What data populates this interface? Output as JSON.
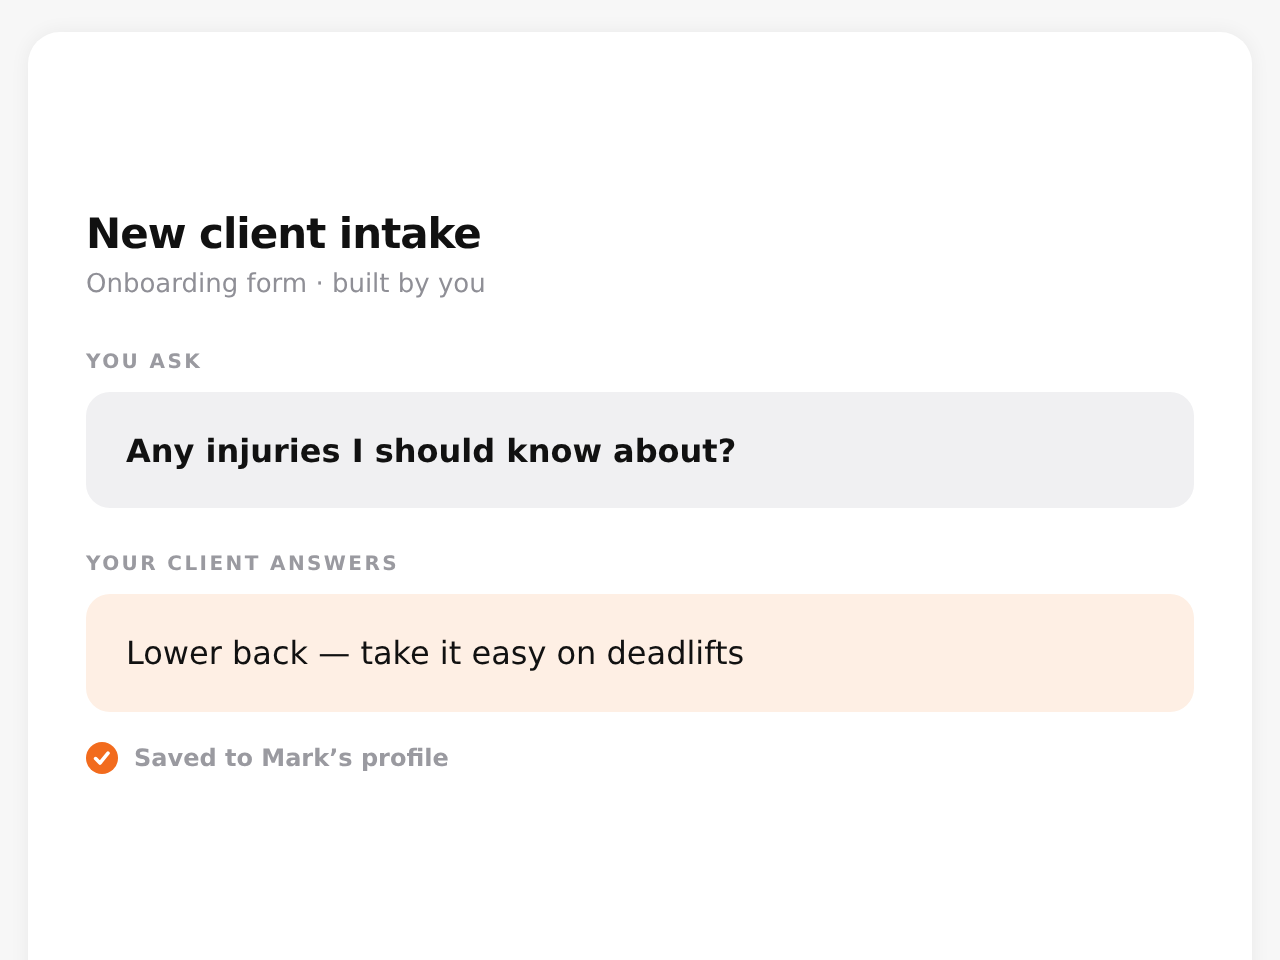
{
  "title": "New client intake",
  "subtitle": "Onboarding form · built by you",
  "question": {
    "label": "YOU ASK",
    "text": "Any injuries I should know about?"
  },
  "answer": {
    "label": "YOUR CLIENT ANSWERS",
    "text": "Lower back — take it easy on deadlifts"
  },
  "status": {
    "saved": true,
    "text": "Saved to Mark’s profile"
  }
}
